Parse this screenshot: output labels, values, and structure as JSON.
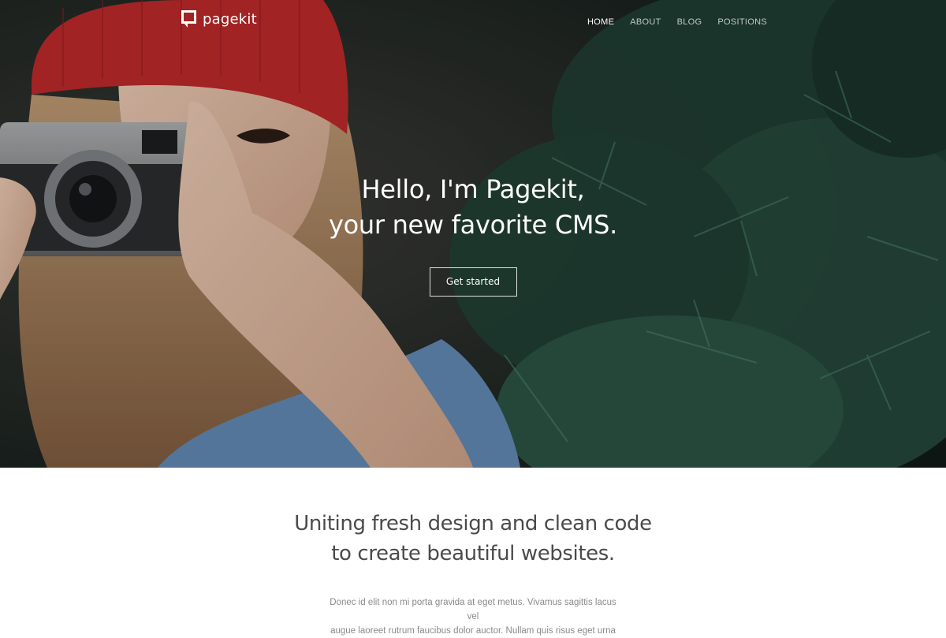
{
  "header": {
    "logo_text": "pagekit",
    "nav": [
      {
        "label": "HOME",
        "active": true
      },
      {
        "label": "ABOUT",
        "active": false
      },
      {
        "label": "BLOG",
        "active": false
      },
      {
        "label": "POSITIONS",
        "active": false
      }
    ]
  },
  "hero": {
    "title_line1": "Hello, I'm Pagekit,",
    "title_line2": "your new favorite CMS.",
    "button_label": "Get started"
  },
  "intro": {
    "title_line1": "Uniting fresh design and clean code",
    "title_line2": "to create beautiful websites.",
    "text_line1": "Donec id elit non mi porta gravida at eget metus. Vivamus sagittis lacus vel",
    "text_line2": "augue laoreet rutrum faucibus dolor auctor. Nullam quis risus eget urna"
  },
  "colors": {
    "hero_dark": "#17251f",
    "hat_red": "#b8282a",
    "foliage": "#2f5a48",
    "text_dark": "#4a4a4a",
    "text_muted": "#8a8a8a"
  },
  "icons": {
    "logo": "pagekit-logo-icon"
  }
}
